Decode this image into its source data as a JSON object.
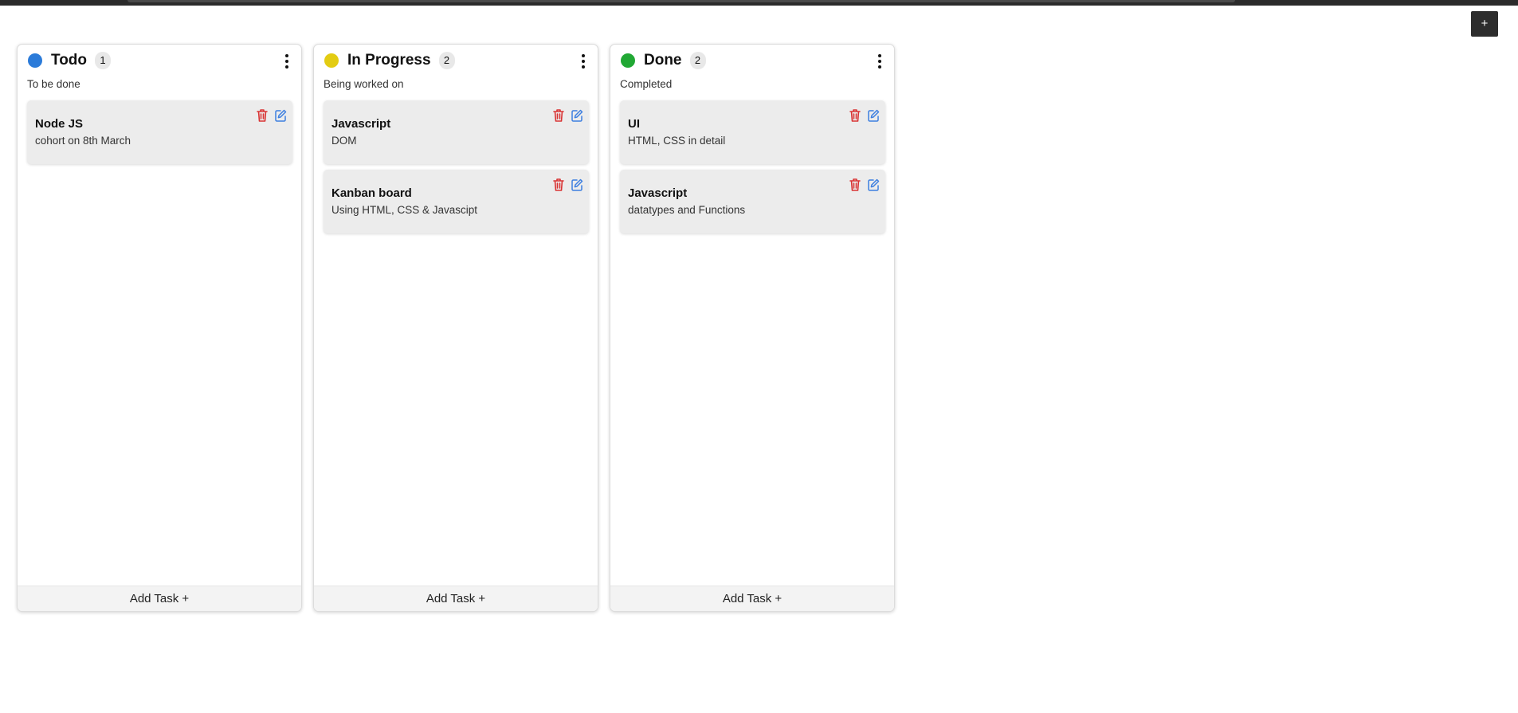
{
  "header": {
    "add_column_label": "+"
  },
  "colors": {
    "todo": "#2b7bd9",
    "in_progress": "#e3cc12",
    "done": "#21a834",
    "trash": "#d93434",
    "edit": "#3d7fe0"
  },
  "icons": {
    "delete": "trash-icon",
    "edit": "edit-icon",
    "menu": "kebab-menu-icon"
  },
  "columns": [
    {
      "title": "Todo",
      "count": "1",
      "description": "To be done",
      "add_task_label": "Add Task +",
      "cards": [
        {
          "title": "Node JS",
          "description": "cohort on 8th March"
        }
      ]
    },
    {
      "title": "In Progress",
      "count": "2",
      "description": "Being worked on",
      "add_task_label": "Add Task +",
      "cards": [
        {
          "title": "Javascript",
          "description": "DOM"
        },
        {
          "title": "Kanban board",
          "description": "Using HTML, CSS & Javascipt"
        }
      ]
    },
    {
      "title": "Done",
      "count": "2",
      "description": "Completed",
      "add_task_label": "Add Task +",
      "cards": [
        {
          "title": "UI",
          "description": "HTML, CSS in detail"
        },
        {
          "title": "Javascript",
          "description": "datatypes and Functions"
        }
      ]
    }
  ]
}
